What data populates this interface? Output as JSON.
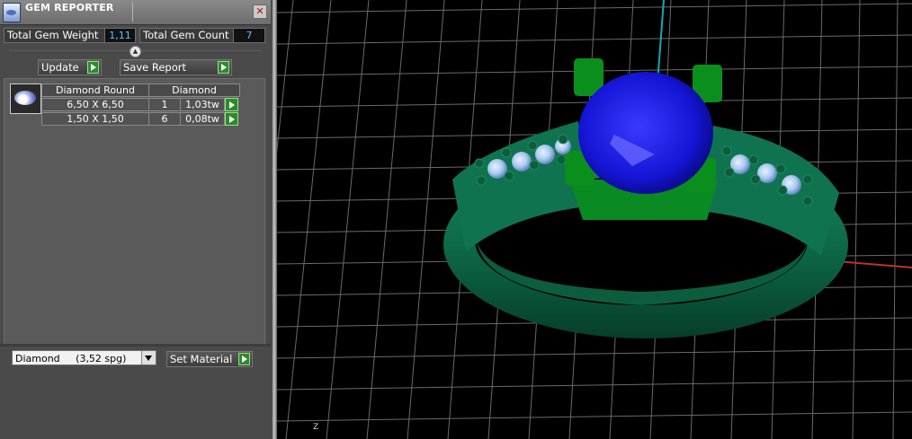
{
  "window": {
    "title": "GEM REPORTER",
    "close_symbol": "✕"
  },
  "summary": {
    "weight_label": "Total Gem Weight",
    "weight_value": "1,11",
    "count_label": "Total Gem Count",
    "count_value": "7"
  },
  "actions": {
    "update_label": "Update",
    "save_report_label": "Save Report"
  },
  "table": {
    "headers": [
      "Diamond Round",
      "Diamond"
    ],
    "rows": [
      {
        "size": "6,50 X 6,50",
        "count": "1",
        "weight": "1,03tw"
      },
      {
        "size": "1,50 X 1,50",
        "count": "6",
        "weight": "0,08tw"
      }
    ]
  },
  "material": {
    "selected": "Diamond     (3,52 spg)",
    "set_label": "Set Material"
  },
  "colors": {
    "panel": "#4a4a4a",
    "value_text": "#5fc4ff",
    "arrow_button": "#2d8a2d",
    "viewport_bg": "#000000",
    "grid": "#9a9a9a",
    "axis_y": "#17a6b8",
    "axis_x": "#c0302b",
    "ring_metal": "#0f6b4a",
    "center_gem": "#1a1ae0",
    "side_gems": "#a9c8ef",
    "prongs": "#0b8f1c"
  },
  "viewport": {
    "axis_marker": "Z"
  }
}
